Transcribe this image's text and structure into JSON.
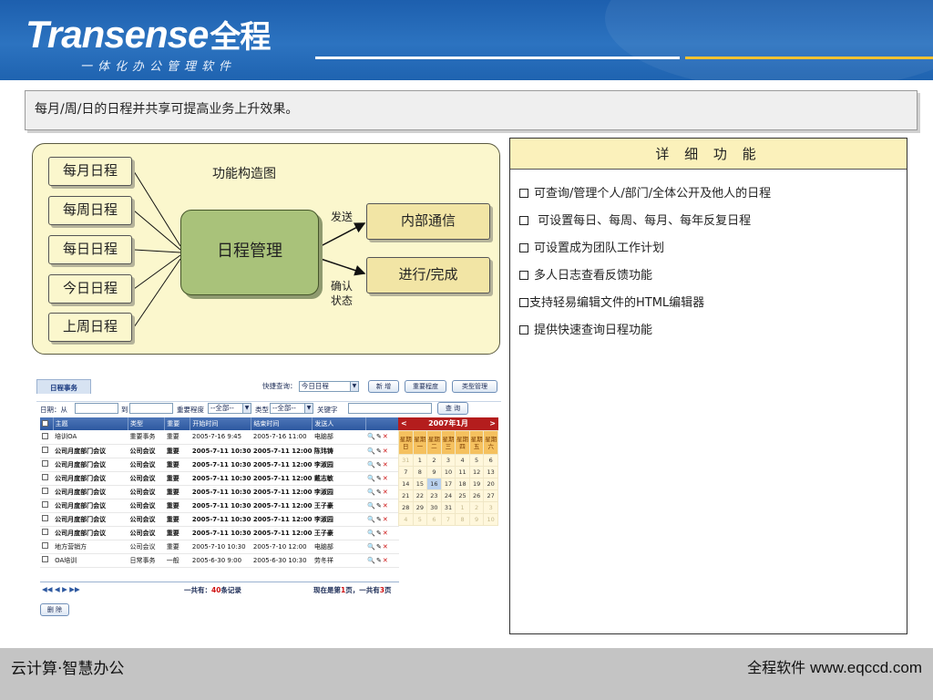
{
  "header": {
    "logo_text": "Transense",
    "logo_cn": "全程",
    "slogan": "一体化办公管理软件",
    "colors": {
      "bg": "#1f63b0",
      "line_white": "#ffffff",
      "line_gold": "#f2c230"
    }
  },
  "intro": "每月/周/日的日程并共享可提高业务上升效果。",
  "diagram": {
    "title": "功能构造图",
    "inputs": [
      "每月日程",
      "每周日程",
      "每日日程",
      "今日日程",
      "上周日程"
    ],
    "center": "日程管理",
    "outputs": [
      "内部通信",
      "进行/完成"
    ],
    "arrow_labels": {
      "send": "发送",
      "confirm": "确认\n状态",
      "confirm_1": "确认",
      "confirm_2": "状态"
    },
    "colors": {
      "bg": "#fbf7cd",
      "center": "#a9c27a",
      "output": "#f2e5a5"
    }
  },
  "details": {
    "title": "详 细 功 能",
    "items": [
      "可查询/管理个人/部门/全体公开及他人的日程",
      " 可设置每日、每周、每月、每年反复日程",
      "可设置成为团队工作计划",
      "多人日志查看反馈功能",
      "支持轻易编辑文件的HTML编辑器",
      "提供快速查询日程功能"
    ]
  },
  "app": {
    "tab": "日程事务",
    "quick_label": "快捷查询：",
    "quick_value": "今日日程",
    "buttons": [
      "新 增",
      "重要程度",
      "类型管理"
    ],
    "filter": {
      "date_from": "日期：从",
      "to": "到",
      "importance_label": "重要程度",
      "importance_value": "--全部--",
      "type_label": "类型",
      "type_value": "--全部--",
      "keyword_label": "关键字",
      "search_button": "查 询"
    },
    "columns": [
      "主题",
      "类型",
      "重要",
      "开始时间",
      "结束时间",
      "发送人"
    ],
    "rows": [
      {
        "subject": "培训OA",
        "type": "重要事务",
        "importance": "重要",
        "start": "2005-7-16 9:45",
        "end": "2005-7-16 11:00",
        "sender": "电脑部",
        "bold": false
      },
      {
        "subject": "公司月度部门会议",
        "type": "公司会议",
        "importance": "重要",
        "start": "2005-7-11 10:30",
        "end": "2005-7-11 12:00",
        "sender": "陈玮铸",
        "bold": true
      },
      {
        "subject": "公司月度部门会议",
        "type": "公司会议",
        "importance": "重要",
        "start": "2005-7-11 10:30",
        "end": "2005-7-11 12:00",
        "sender": "李淑园",
        "bold": true
      },
      {
        "subject": "公司月度部门会议",
        "type": "公司会议",
        "importance": "重要",
        "start": "2005-7-11 10:30",
        "end": "2005-7-11 12:00",
        "sender": "戴志敏",
        "bold": true
      },
      {
        "subject": "公司月度部门会议",
        "type": "公司会议",
        "importance": "重要",
        "start": "2005-7-11 10:30",
        "end": "2005-7-11 12:00",
        "sender": "李淑园",
        "bold": true
      },
      {
        "subject": "公司月度部门会议",
        "type": "公司会议",
        "importance": "重要",
        "start": "2005-7-11 10:30",
        "end": "2005-7-11 12:00",
        "sender": "王子豪",
        "bold": true
      },
      {
        "subject": "公司月度部门会议",
        "type": "公司会议",
        "importance": "重要",
        "start": "2005-7-11 10:30",
        "end": "2005-7-11 12:00",
        "sender": "李淑园",
        "bold": true
      },
      {
        "subject": "公司月度部门会议",
        "type": "公司会议",
        "importance": "重要",
        "start": "2005-7-11 10:30",
        "end": "2005-7-11 12:00",
        "sender": "王子豪",
        "bold": true
      },
      {
        "subject": "地方营销方",
        "type": "公司会议",
        "importance": "重要",
        "start": "2005-7-10 10:30",
        "end": "2005-7-10 12:00",
        "sender": "电脑部",
        "bold": false
      },
      {
        "subject": "OA培训",
        "type": "日常事务",
        "importance": "一般",
        "start": "2005-6-30 9:00",
        "end": "2005-6-30 10:30",
        "sender": "劳冬祥",
        "bold": false
      }
    ],
    "row_actions": {
      "view": "🔍",
      "edit": "✎",
      "delete": "✕"
    },
    "pager": {
      "nav": "◀◀  ◀   ▶   ▶▶",
      "total_pre": "一共有：",
      "total_count": "40",
      "total_post": "条记录",
      "page_pre": "现在是第",
      "page_current": "1",
      "page_mid": "页，一共有",
      "page_total": "3",
      "page_post": "页"
    },
    "delete_button": "删 除",
    "calendar": {
      "title": "2007年1月",
      "prev": "<",
      "next": ">",
      "weekdays": [
        "星期日",
        "星期一",
        "星期二",
        "星期三",
        "星期四",
        "星期五",
        "星期六"
      ],
      "weeks": [
        [
          "31",
          "1",
          "2",
          "3",
          "4",
          "5",
          "6"
        ],
        [
          "7",
          "8",
          "9",
          "10",
          "11",
          "12",
          "13"
        ],
        [
          "14",
          "15",
          "16",
          "17",
          "18",
          "19",
          "20"
        ],
        [
          "21",
          "22",
          "23",
          "24",
          "25",
          "26",
          "27"
        ],
        [
          "28",
          "29",
          "30",
          "31",
          "1",
          "2",
          "3"
        ],
        [
          "4",
          "5",
          "6",
          "7",
          "8",
          "9",
          "10"
        ]
      ],
      "today": "16"
    }
  },
  "footer": {
    "left": "云计算·智慧办公",
    "right_cn": "全程软件",
    "right_url": "www.eqccd.com"
  }
}
